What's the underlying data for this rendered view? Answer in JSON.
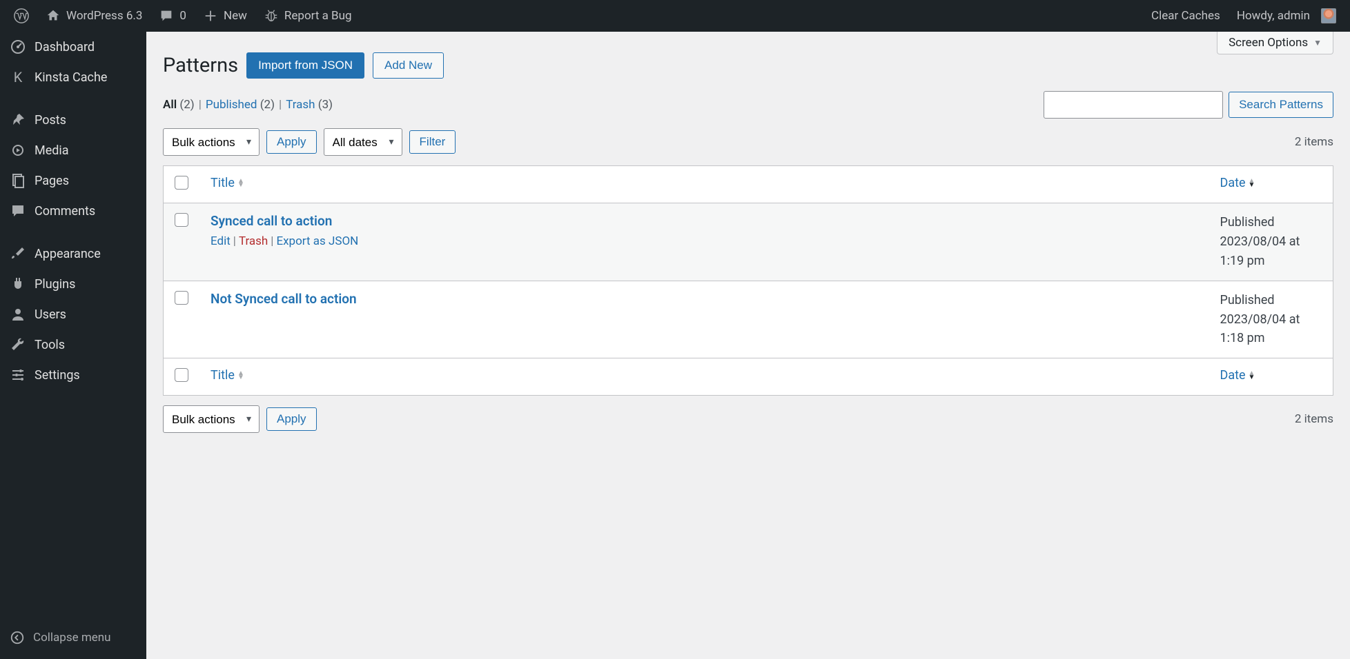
{
  "adminbar": {
    "site_title": "WordPress 6.3",
    "comments_count": "0",
    "new_label": "New",
    "bug_label": "Report a Bug",
    "clear_caches": "Clear Caches",
    "howdy": "Howdy, admin"
  },
  "sidebar": {
    "items": [
      {
        "label": "Dashboard"
      },
      {
        "label": "Kinsta Cache"
      },
      {
        "label": "Posts"
      },
      {
        "label": "Media"
      },
      {
        "label": "Pages"
      },
      {
        "label": "Comments"
      },
      {
        "label": "Appearance"
      },
      {
        "label": "Plugins"
      },
      {
        "label": "Users"
      },
      {
        "label": "Tools"
      },
      {
        "label": "Settings"
      }
    ],
    "collapse": "Collapse menu"
  },
  "screen_options": "Screen Options",
  "page": {
    "title": "Patterns",
    "import_btn": "Import from JSON",
    "addnew_btn": "Add New"
  },
  "filters": {
    "all_label": "All",
    "all_count": "(2)",
    "published_label": "Published",
    "published_count": "(2)",
    "trash_label": "Trash",
    "trash_count": "(3)"
  },
  "search": {
    "btn": "Search Patterns"
  },
  "bulk": {
    "bulk_actions": "Bulk actions",
    "apply": "Apply",
    "all_dates": "All dates",
    "filter": "Filter"
  },
  "items_count": "2 items",
  "columns": {
    "title": "Title",
    "date": "Date"
  },
  "rows": [
    {
      "title": "Synced call to action",
      "show_actions": true,
      "edit": "Edit",
      "trash": "Trash",
      "export": "Export as JSON",
      "status": "Published",
      "dateline": "2023/08/04 at 1:19 pm"
    },
    {
      "title": "Not Synced call to action",
      "show_actions": false,
      "status": "Published",
      "dateline": "2023/08/04 at 1:18 pm"
    }
  ]
}
